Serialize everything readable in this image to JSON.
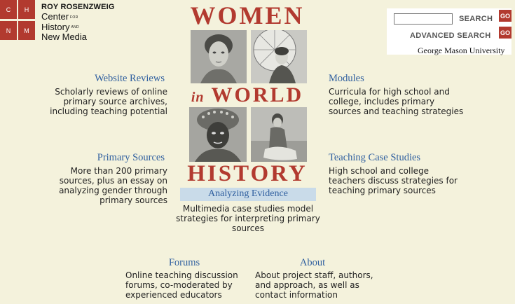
{
  "logo": {
    "letters": [
      "C",
      "H",
      "N",
      "M"
    ],
    "line1": "ROY ROSENZWEIG",
    "line2": "Center",
    "line2_small": "FOR",
    "line3": "History",
    "line3_small": "AND",
    "line4": "New Media",
    "color": "#b23a2f"
  },
  "search": {
    "input_value": "",
    "search_label": "SEARCH",
    "advanced_label": "ADVANCED SEARCH",
    "go_label": "GO",
    "university": "George Mason University"
  },
  "title": {
    "women": "WOMEN",
    "in": "in",
    "world": "WORLD",
    "history": "HISTORY",
    "color": "#b23a2f"
  },
  "sections": {
    "website_reviews": {
      "heading": "Website Reviews",
      "lines": [
        "Scholarly reviews of online",
        "primary source archives,",
        "including teaching potential"
      ]
    },
    "primary_sources": {
      "heading": "Primary Sources",
      "lines": [
        "More than 200 primary",
        "sources, plus an essay on",
        "analyzing gender through",
        "primary sources"
      ]
    },
    "modules": {
      "heading": "Modules",
      "lines": [
        "Curricula for high school and",
        "college, includes primary",
        "sources and teaching strategies"
      ]
    },
    "teaching_case_studies": {
      "heading": "Teaching Case Studies",
      "lines": [
        "High school and college",
        "teachers discuss strategies for",
        "teaching primary sources"
      ]
    },
    "analyzing_evidence": {
      "heading": "Analyzing Evidence",
      "lines": [
        "Multimedia case studies model",
        "strategies for interpreting primary",
        "sources"
      ]
    },
    "forums": {
      "heading": "Forums",
      "lines": [
        "Online teaching discussion",
        "forums, co-moderated by",
        "experienced educators"
      ]
    },
    "about": {
      "heading": "About",
      "lines": [
        "About project staff, authors,",
        "and approach, as well as",
        "contact information"
      ]
    }
  },
  "colors": {
    "background": "#f4f2dc",
    "link": "#2f5f9f",
    "accent": "#b23a2f",
    "evidence_band": "#c9dbe9"
  }
}
